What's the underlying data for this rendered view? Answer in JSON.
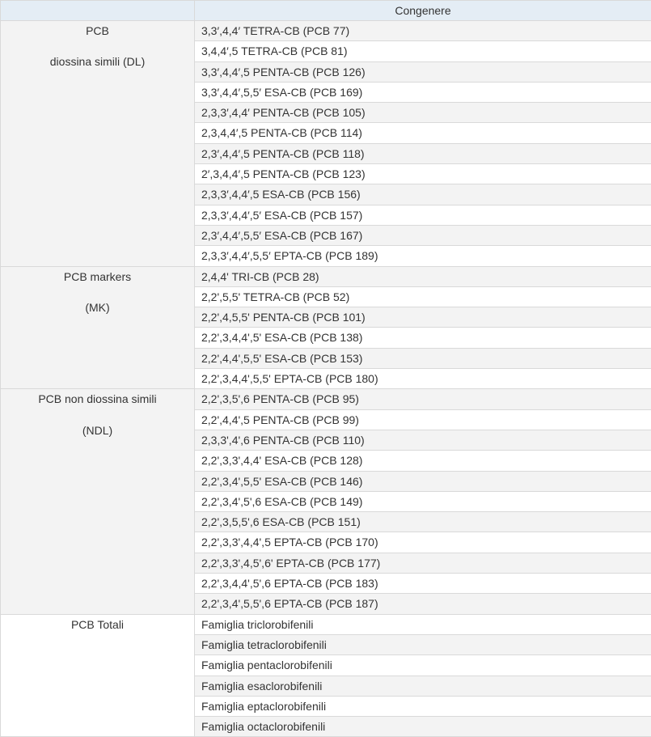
{
  "header": {
    "col1": "",
    "col2": "Congenere"
  },
  "groups": [
    {
      "label_line1": "PCB",
      "label_line2": "diossina simili (DL)",
      "cat_bg": "grey",
      "items": [
        "3,3′,4,4′ TETRA-CB (PCB 77)",
        "3,4,4′,5 TETRA-CB (PCB 81)",
        "3,3′,4,4′,5 PENTA-CB (PCB 126)",
        "3,3′,4,4′,5,5′ ESA-CB (PCB 169)",
        "2,3,3′,4,4′ PENTA-CB (PCB 105)",
        "2,3,4,4′,5 PENTA-CB (PCB 114)",
        "2,3′,4,4′,5 PENTA-CB (PCB 118)",
        "2′,3,4,4′,5 PENTA-CB (PCB 123)",
        "2,3,3′,4,4′,5 ESA-CB (PCB 156)",
        "2,3,3′,4,4′,5′ ESA-CB (PCB 157)",
        "2,3′,4,4′,5,5′ ESA-CB (PCB 167)",
        "2,3,3′,4,4′,5,5′ EPTA-CB (PCB 189)"
      ]
    },
    {
      "label_line1": "PCB markers",
      "label_line2": "(MK)",
      "cat_bg": "grey",
      "items": [
        "2,4,4' TRI-CB (PCB 28)",
        "2,2',5,5' TETRA-CB (PCB 52)",
        "2,2',4,5,5' PENTA-CB (PCB 101)",
        "2,2',3,4,4',5' ESA-CB (PCB 138)",
        "2,2',4,4',5,5' ESA-CB (PCB 153)",
        "2,2',3,4,4',5,5' EPTA-CB (PCB 180)"
      ]
    },
    {
      "label_line1": "PCB non diossina simili",
      "label_line2": "(NDL)",
      "cat_bg": "grey",
      "items": [
        "2,2',3,5',6 PENTA-CB (PCB 95)",
        "2,2',4,4',5 PENTA-CB (PCB 99)",
        "2,3,3',4',6 PENTA-CB (PCB 110)",
        "2,2',3,3',4,4' ESA-CB (PCB 128)",
        "2,2',3,4',5,5' ESA-CB (PCB 146)",
        "2,2',3,4',5',6 ESA-CB (PCB 149)",
        "2,2',3,5,5',6 ESA-CB (PCB 151)",
        "2,2',3,3',4,4',5 EPTA-CB (PCB 170)",
        "2,2',3,3',4,5',6' EPTA-CB (PCB 177)",
        "2,2',3,4,4',5',6 EPTA-CB (PCB 183)",
        "2,2',3,4',5,5',6 EPTA-CB (PCB 187)"
      ]
    },
    {
      "label_line1": "PCB Totali",
      "label_line2": "",
      "cat_bg": "white",
      "items": [
        "Famiglia triclorobifenili",
        "Famiglia tetraclorobifenili",
        "Famiglia pentaclorobifenili",
        "Famiglia esaclorobifenili",
        "Famiglia eptaclorobifenili",
        "Famiglia octaclorobifenili"
      ]
    }
  ]
}
